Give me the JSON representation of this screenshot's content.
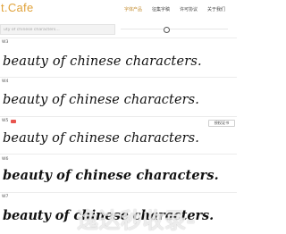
{
  "header": {
    "logo": "t.Cafe",
    "nav": [
      "字体产品",
      "征集字稿",
      "许可协议",
      "关于我们"
    ]
  },
  "search": {
    "placeholder": "uty of chinese characters..."
  },
  "fonts": [
    {
      "tag": "W3",
      "sample": "beauty of chinese characters."
    },
    {
      "tag": "W4",
      "sample": "beauty of chinese characters."
    },
    {
      "tag": "W5",
      "badge_color": "#e8544e",
      "action": "授权证书",
      "sample": "beauty of chinese characters."
    },
    {
      "tag": "W6",
      "sample": "beauty of chinese characters."
    },
    {
      "tag": "W7",
      "sample": "beauty of chinese characters."
    }
  ],
  "watermark": "逸达秒收录-"
}
